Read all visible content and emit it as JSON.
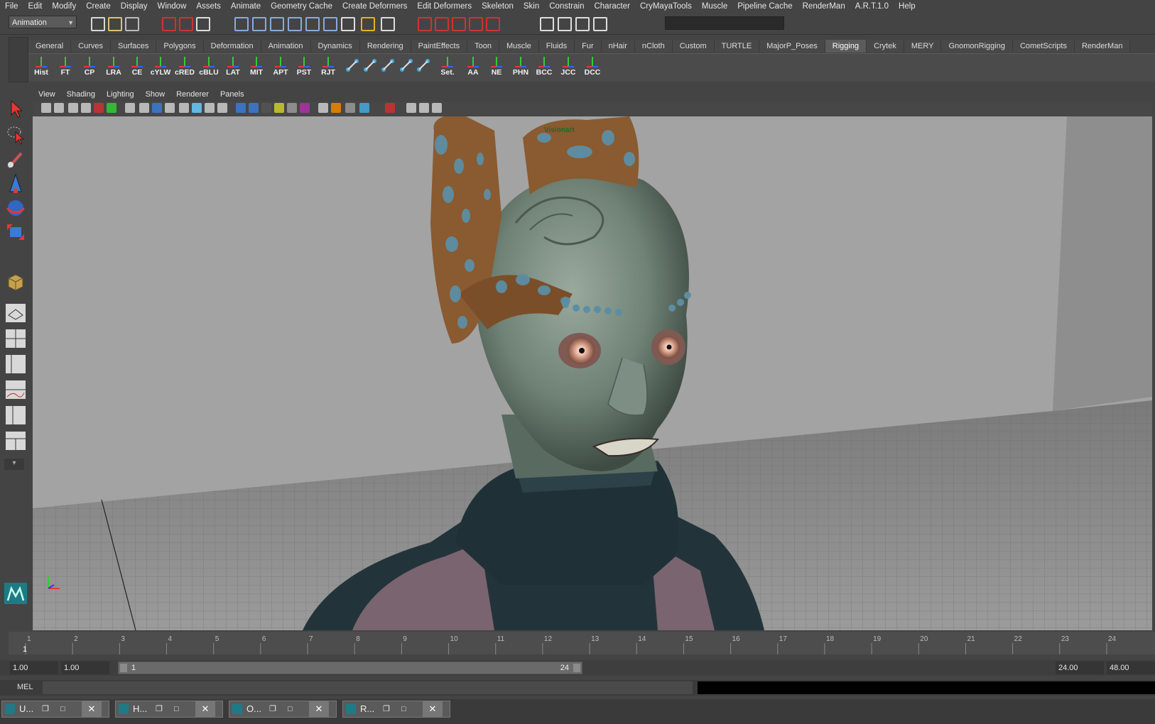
{
  "menubar": [
    "File",
    "Edit",
    "Modify",
    "Create",
    "Display",
    "Window",
    "Assets",
    "Animate",
    "Geometry Cache",
    "Create Deformers",
    "Edit Deformers",
    "Skeleton",
    "Skin",
    "Constrain",
    "Character",
    "CryMayaTools",
    "Muscle",
    "Pipeline Cache",
    "RenderMan",
    "A.R.T.1.0",
    "Help"
  ],
  "status": {
    "mode": "Animation"
  },
  "shelf_tabs": [
    "General",
    "Curves",
    "Surfaces",
    "Polygons",
    "Deformation",
    "Animation",
    "Dynamics",
    "Rendering",
    "PaintEffects",
    "Toon",
    "Muscle",
    "Fluids",
    "Fur",
    "nHair",
    "nCloth",
    "Custom",
    "TURTLE",
    "MajorP_Poses",
    "Rigging",
    "Crytek",
    "MERY",
    "GnomonRigging",
    "CometScripts",
    "RenderMan"
  ],
  "active_shelf_tab": "Rigging",
  "shelf_buttons": [
    "Hist",
    "FT",
    "CP",
    "LRA",
    "CE",
    "cYLW",
    "cRED",
    "cBLU",
    "LAT",
    "MIT",
    "APT",
    "PST",
    "RJT",
    "",
    "",
    "",
    "",
    "",
    "Set.",
    "AA",
    "NE",
    "PHN",
    "BCC",
    "JCC",
    "DCC"
  ],
  "panel_menu": [
    "View",
    "Shading",
    "Lighting",
    "Show",
    "Renderer",
    "Panels"
  ],
  "viewport_overlay": {
    "frame_text": "Visionart"
  },
  "timeline": {
    "current_frame": "1",
    "ticks": [
      "1",
      "2",
      "3",
      "4",
      "5",
      "6",
      "7",
      "8",
      "9",
      "10",
      "11",
      "12",
      "13",
      "14",
      "15",
      "16",
      "17",
      "18",
      "19",
      "20",
      "21",
      "22",
      "23",
      "24"
    ]
  },
  "range": {
    "start_time": "1.00",
    "playback_start": "1.00",
    "slider_start": "1",
    "slider_end": "24",
    "playback_end": "24.00",
    "end_time": "48.00"
  },
  "commandline": {
    "label": "MEL"
  },
  "taskbar": [
    {
      "label": "U..."
    },
    {
      "label": "H..."
    },
    {
      "label": "O..."
    },
    {
      "label": "R..."
    }
  ],
  "colors": {
    "accent": "#1e7b86",
    "ui_bg": "#444444",
    "viewport": "#a1a1a1",
    "skin": "#6f8275",
    "hair": "#8a5a30"
  }
}
